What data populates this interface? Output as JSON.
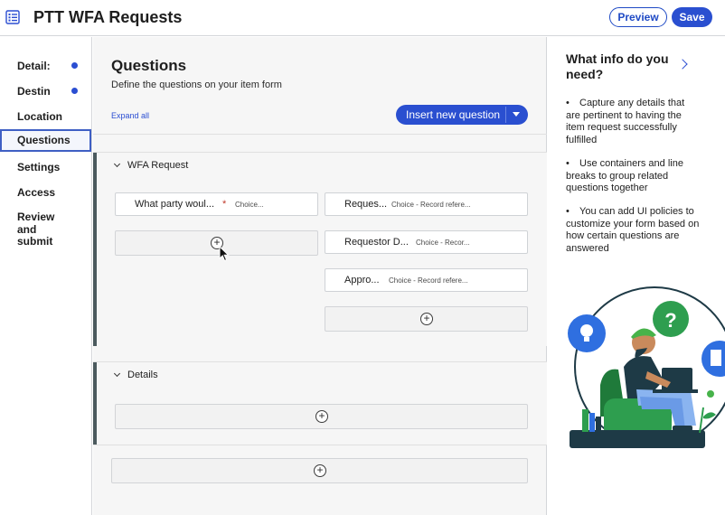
{
  "header": {
    "title": "PTT WFA Requests",
    "preview_label": "Preview",
    "save_label": "Save"
  },
  "sidebar": {
    "items": [
      {
        "label": "Detail:",
        "dot": true
      },
      {
        "label": "Destin",
        "dot": true
      },
      {
        "label": "Location",
        "dot": false
      },
      {
        "label": "Questions",
        "dot": false,
        "active": true
      },
      {
        "label": "Settings",
        "dot": false
      },
      {
        "label": "Access",
        "dot": false
      },
      {
        "label": "Review and submit",
        "dot": false
      }
    ]
  },
  "main": {
    "title": "Questions",
    "subtitle": "Define the questions on your item form",
    "expand_all": "Expand all",
    "insert_label": "Insert new question",
    "sections": [
      {
        "name": "WFA Request",
        "questions": [
          {
            "name": "What party woul...",
            "type": "Choice...",
            "required": true,
            "required_mark": "*"
          },
          {
            "name": "Reques...",
            "type": "Choice - Record refere..."
          },
          {
            "name": "Requestor D...",
            "type": "Choice - Recor..."
          },
          {
            "name": "Appro...",
            "type": "Choice - Record refere..."
          }
        ]
      },
      {
        "name": "Details",
        "questions": []
      }
    ],
    "plus_glyph": "+"
  },
  "right_panel": {
    "title": "What info do you need?",
    "bullet": "•",
    "tips": [
      "Capture any details that are pertinent to having the item request successfully fulfilled",
      "Use containers and line breaks to group related questions together",
      "You can add UI policies to customize your form based on how certain questions are answered"
    ],
    "illustration_mark": "?"
  },
  "colors": {
    "accent": "#2a4fd0",
    "section_bar": "#4b5a5e",
    "main_bg": "#f6f6f6",
    "required": "#c0392b"
  }
}
